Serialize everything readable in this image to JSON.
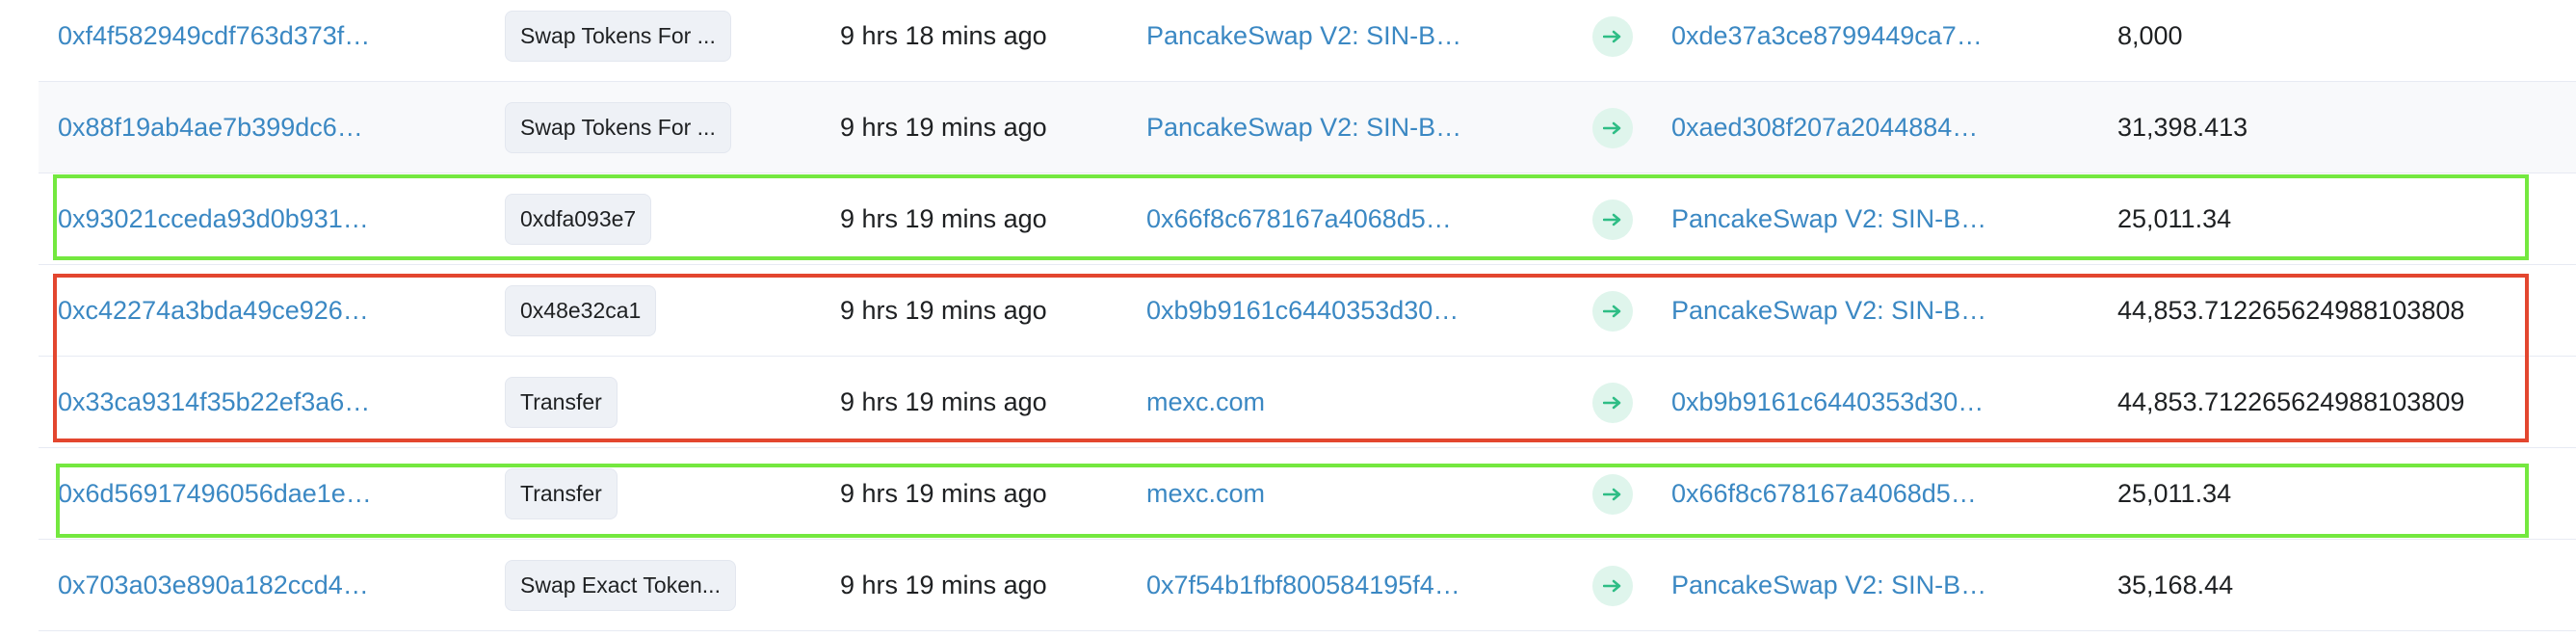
{
  "transactions": [
    {
      "hash": "0xf4f582949cdf763d373f…",
      "method": "Swap Tokens For ...",
      "age": "9 hrs 18 mins ago",
      "from": "PancakeSwap V2: SIN-B…",
      "to": "0xde37a3ce8799449ca7…",
      "quantity": "8,000"
    },
    {
      "hash": "0x88f19ab4ae7b399dc6…",
      "method": "Swap Tokens For ...",
      "age": "9 hrs 19 mins ago",
      "from": "PancakeSwap V2: SIN-B…",
      "to": "0xaed308f207a2044884…",
      "quantity": "31,398.413"
    },
    {
      "hash": "0x93021cceda93d0b931…",
      "method": "0xdfa093e7",
      "age": "9 hrs 19 mins ago",
      "from": "0x66f8c678167a4068d5…",
      "to": "PancakeSwap V2: SIN-B…",
      "quantity": "25,011.34"
    },
    {
      "hash": "0xc42274a3bda49ce926…",
      "method": "0x48e32ca1",
      "age": "9 hrs 19 mins ago",
      "from": "0xb9b9161c6440353d30…",
      "to": "PancakeSwap V2: SIN-B…",
      "quantity": "44,853.712265624988103808"
    },
    {
      "hash": "0x33ca9314f35b22ef3a6…",
      "method": "Transfer",
      "age": "9 hrs 19 mins ago",
      "from": "mexc.com",
      "to": "0xb9b9161c6440353d30…",
      "quantity": "44,853.712265624988103809"
    },
    {
      "hash": "0x6d56917496056dae1e…",
      "method": "Transfer",
      "age": "9 hrs 19 mins ago",
      "from": "mexc.com",
      "to": "0x66f8c678167a4068d5…",
      "quantity": "25,011.34"
    },
    {
      "hash": "0x703a03e890a182ccd4…",
      "method": "Swap Exact Token...",
      "age": "9 hrs 19 mins ago",
      "from": "0x7f54b1fbf800584195f4…",
      "to": "PancakeSwap V2: SIN-B…",
      "quantity": "35,168.44"
    }
  ],
  "icons": {
    "direction": "arrow-right-icon"
  },
  "colors": {
    "link": "#3b88c3",
    "arrow": "#2ebd85",
    "arrow_bg": "#dff5ec",
    "highlight_green": "#74e83f",
    "highlight_red": "#e3462f"
  }
}
